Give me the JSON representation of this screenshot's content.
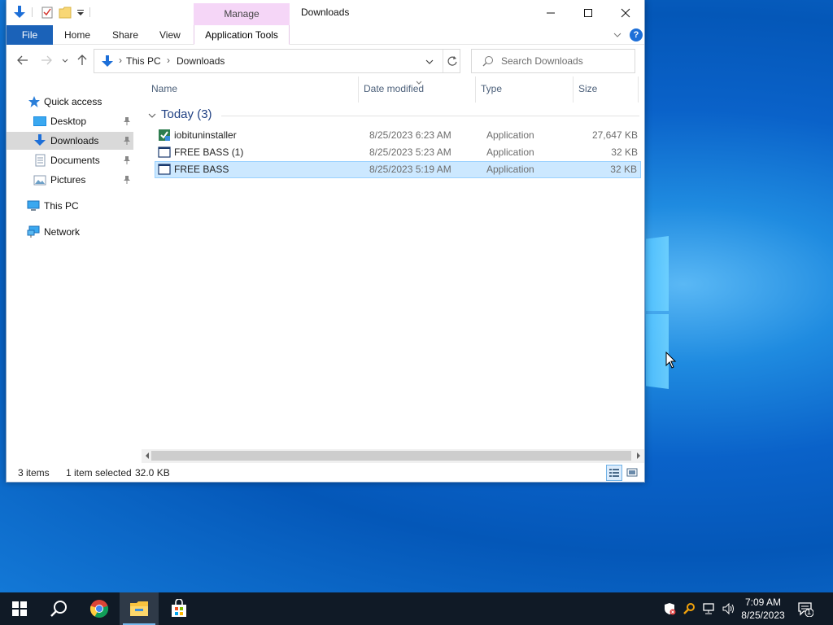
{
  "window": {
    "title": "Downloads",
    "contextual_tab_group": "Manage"
  },
  "ribbon": {
    "tabs": [
      "File",
      "Home",
      "Share",
      "View",
      "Application Tools"
    ]
  },
  "address": {
    "breadcrumbs": [
      "This PC",
      "Downloads"
    ],
    "search_placeholder": "Search Downloads"
  },
  "nav_pane": {
    "items": [
      {
        "label": "Quick access",
        "icon": "star-icon"
      },
      {
        "label": "Desktop",
        "icon": "desktop-folder-icon",
        "pinned": true
      },
      {
        "label": "Downloads",
        "icon": "downloads-folder-icon",
        "pinned": true,
        "selected": true
      },
      {
        "label": "Documents",
        "icon": "documents-folder-icon",
        "pinned": true
      },
      {
        "label": "Pictures",
        "icon": "pictures-folder-icon",
        "pinned": true
      },
      {
        "label": "This PC",
        "icon": "computer-icon"
      },
      {
        "label": "Network",
        "icon": "network-icon"
      }
    ]
  },
  "file_list": {
    "columns": [
      "Name",
      "Date modified",
      "Type",
      "Size"
    ],
    "group_label": "Today (3)",
    "rows": [
      {
        "name": "iobituninstaller",
        "date": "8/25/2023 6:23 AM",
        "type": "Application",
        "size": "27,647 KB",
        "icon": "installer-icon",
        "selected": false
      },
      {
        "name": "FREE BASS (1)",
        "date": "8/25/2023 5:23 AM",
        "type": "Application",
        "size": "32 KB",
        "icon": "app-window-icon",
        "selected": false
      },
      {
        "name": "FREE BASS",
        "date": "8/25/2023 5:19 AM",
        "type": "Application",
        "size": "32 KB",
        "icon": "app-window-icon",
        "selected": true
      }
    ]
  },
  "status_bar": {
    "item_count": "3 items",
    "selection": "1 item selected",
    "selection_size": "32.0 KB"
  },
  "taskbar": {
    "apps": [
      "start-icon",
      "search-icon",
      "chrome-icon",
      "file-explorer-icon",
      "store-icon"
    ],
    "time": "7:09 AM",
    "date": "8/25/2023",
    "notification_count": "1"
  },
  "colors": {
    "accent": "#1b62b8",
    "selection_bg": "#cce8ff",
    "manage_tab": "#f5d6f7",
    "taskbar": "#101a26"
  }
}
